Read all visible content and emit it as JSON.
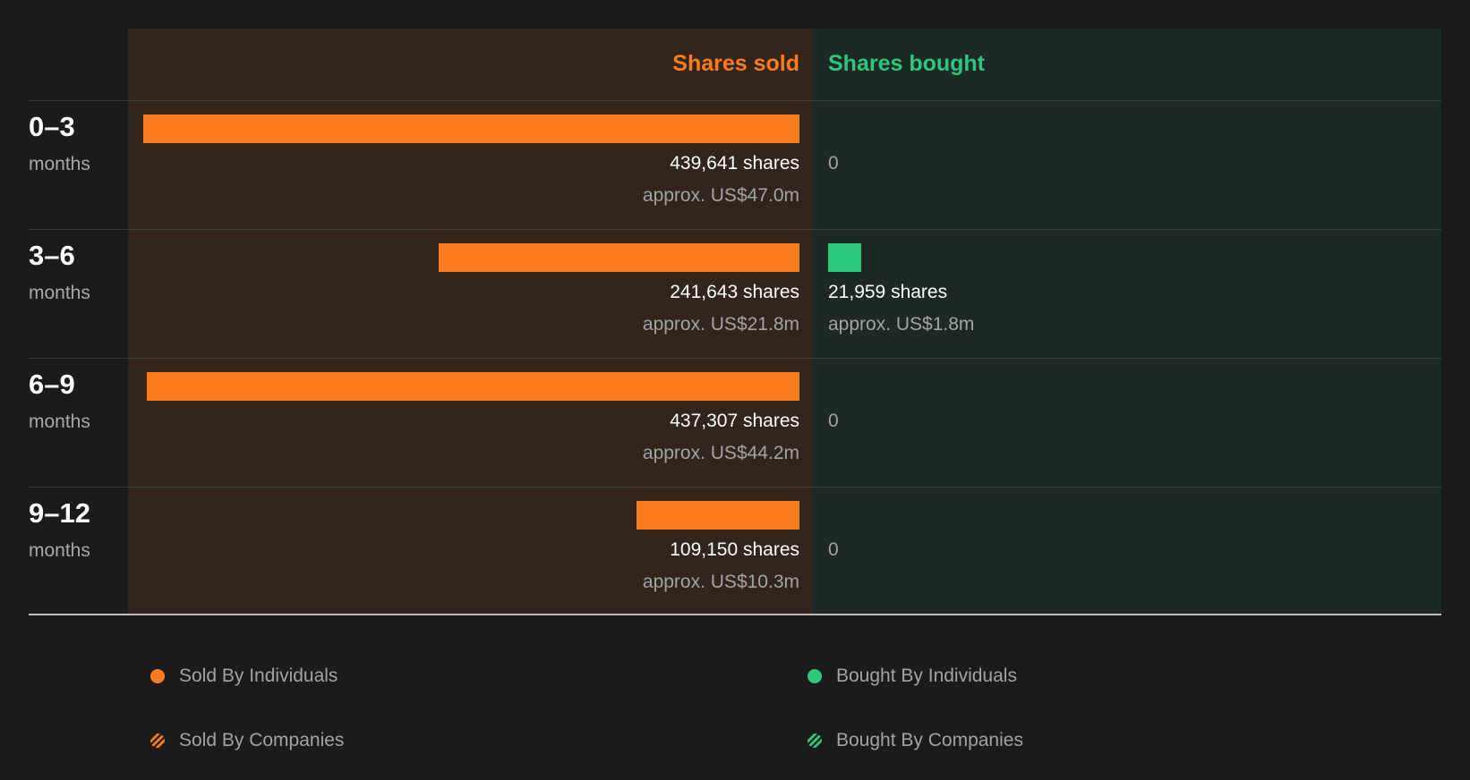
{
  "headers": {
    "sold": "Shares sold",
    "bought": "Shares bought"
  },
  "colors": {
    "sold": "#fc7b1e",
    "bought": "#2ec67c",
    "sold_panel": "#33241c",
    "bought_panel": "#1c2924"
  },
  "rows": [
    {
      "period": "0–3",
      "unit": "months",
      "sold_shares_label": "439,641 shares",
      "sold_value_label": "approx. US$47.0m",
      "bought_shares_label": "0",
      "bought_value_label": ""
    },
    {
      "period": "3–6",
      "unit": "months",
      "sold_shares_label": "241,643 shares",
      "sold_value_label": "approx. US$21.8m",
      "bought_shares_label": "21,959 shares",
      "bought_value_label": "approx. US$1.8m"
    },
    {
      "period": "6–9",
      "unit": "months",
      "sold_shares_label": "437,307 shares",
      "sold_value_label": "approx. US$44.2m",
      "bought_shares_label": "0",
      "bought_value_label": ""
    },
    {
      "period": "9–12",
      "unit": "months",
      "sold_shares_label": "109,150 shares",
      "sold_value_label": "approx. US$10.3m",
      "bought_shares_label": "0",
      "bought_value_label": ""
    }
  ],
  "legend": {
    "sold_individuals": "Sold By Individuals",
    "sold_companies": "Sold By Companies",
    "bought_individuals": "Bought By Individuals",
    "bought_companies": "Bought By Companies"
  },
  "chart_data": {
    "type": "bar",
    "categories": [
      "0–3 months",
      "3–6 months",
      "6–9 months",
      "9–12 months"
    ],
    "series": [
      {
        "name": "Shares sold",
        "values": [
          439641,
          241643,
          437307,
          109150
        ]
      },
      {
        "name": "Shares bought",
        "values": [
          0,
          21959,
          0,
          0
        ]
      }
    ],
    "value_usd_m": {
      "sold": [
        47.0,
        21.8,
        44.2,
        10.3
      ],
      "bought": [
        0,
        1.8,
        0,
        0
      ]
    },
    "legend_entries": [
      "Sold By Individuals",
      "Sold By Companies",
      "Bought By Individuals",
      "Bought By Companies"
    ],
    "legend_placement": "bottom",
    "orientation": "horizontal",
    "grid": false
  }
}
